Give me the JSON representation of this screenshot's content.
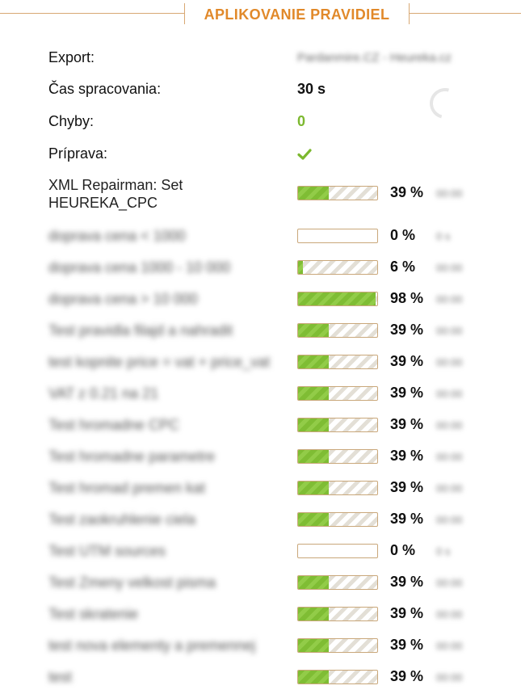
{
  "header": {
    "title": "APLIKOVANIE PRAVIDIEL"
  },
  "info": {
    "export_label": "Export:",
    "export_value": "Pardanmire.CZ - Heureka.cz",
    "time_label": "Čas spracovania:",
    "time_value": "30 s",
    "errors_label": "Chyby:",
    "errors_value": "0",
    "prep_label": "Príprava:"
  },
  "colors": {
    "accent": "#e1892a",
    "success": "#7cb82f",
    "border": "#d8a873"
  },
  "rules": [
    {
      "label": "XML Repairman: Set HEUREKA_CPC",
      "label_line1": "XML Repairman: Set",
      "label_line2": "HEUREKA_CPC",
      "percent": 39,
      "percent_text": "39 %",
      "extra": "00:00",
      "blurred": false
    },
    {
      "label": "doprava cena < 1000",
      "percent": 0,
      "percent_text": "0 %",
      "extra": "0 s",
      "blurred": true
    },
    {
      "label": "doprava cena 1000 - 10 000",
      "percent": 6,
      "percent_text": "6 %",
      "extra": "00:00",
      "blurred": true
    },
    {
      "label": "doprava cena > 10 000",
      "percent": 98,
      "percent_text": "98 %",
      "extra": "00:00",
      "blurred": true
    },
    {
      "label": "Test pravidla filajd a nahradit",
      "percent": 39,
      "percent_text": "39 %",
      "extra": "00:00",
      "blurred": true
    },
    {
      "label": "test kopnite price = vat + price_vat",
      "percent": 39,
      "percent_text": "39 %",
      "extra": "00:00",
      "blurred": true
    },
    {
      "label": "VAT z 0.21 na 21",
      "percent": 39,
      "percent_text": "39 %",
      "extra": "00:00",
      "blurred": true
    },
    {
      "label": "Test hromadne CPC",
      "percent": 39,
      "percent_text": "39 %",
      "extra": "00:00",
      "blurred": true
    },
    {
      "label": "Test hromadne parametre",
      "percent": 39,
      "percent_text": "39 %",
      "extra": "00:00",
      "blurred": true
    },
    {
      "label": "Test hromad premen kat",
      "percent": 39,
      "percent_text": "39 %",
      "extra": "00:00",
      "blurred": true
    },
    {
      "label": "Test zaokruhlenie ciela",
      "percent": 39,
      "percent_text": "39 %",
      "extra": "00:00",
      "blurred": true
    },
    {
      "label": "Test UTM sources",
      "percent": 0,
      "percent_text": "0 %",
      "extra": "0 s",
      "blurred": true
    },
    {
      "label": "Test Zmeny velkost pisma",
      "percent": 39,
      "percent_text": "39 %",
      "extra": "00:00",
      "blurred": true
    },
    {
      "label": "Test skratenie",
      "percent": 39,
      "percent_text": "39 %",
      "extra": "00:00",
      "blurred": true
    },
    {
      "label": "test nova elementy a premennej",
      "percent": 39,
      "percent_text": "39 %",
      "extra": "00:00",
      "blurred": true
    },
    {
      "label": "test",
      "percent": 39,
      "percent_text": "39 %",
      "extra": "00:00",
      "blurred": true
    }
  ]
}
